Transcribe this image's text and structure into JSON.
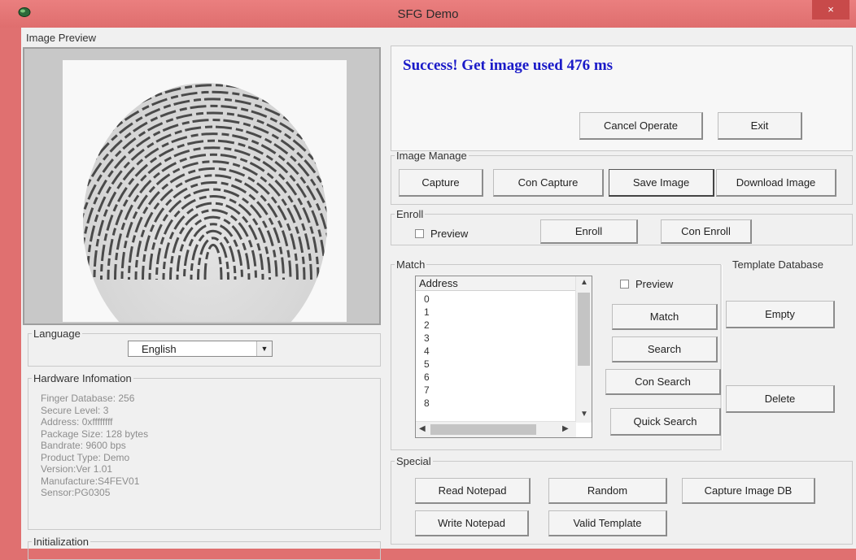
{
  "window": {
    "title": "SFG Demo",
    "close_glyph": "×",
    "icon": "app-icon"
  },
  "preview": {
    "label": "Image Preview",
    "image": "fingerprint-image"
  },
  "status": {
    "message": "Success! Get image used 476 ms",
    "cancel_label": "Cancel Operate",
    "exit_label": "Exit"
  },
  "image_manage": {
    "title": "Image Manage",
    "capture": "Capture",
    "con_capture": "Con Capture",
    "save_image": "Save Image",
    "download_image": "Download Image"
  },
  "enroll": {
    "title": "Enroll",
    "preview_label": "Preview",
    "preview_checked": false,
    "enroll_label": "Enroll",
    "con_enroll_label": "Con Enroll"
  },
  "match": {
    "title": "Match",
    "list_header": "Address",
    "addresses": [
      "0",
      "1",
      "2",
      "3",
      "4",
      "5",
      "6",
      "7",
      "8"
    ],
    "preview_label": "Preview",
    "preview_checked": false,
    "match_label": "Match",
    "search_label": "Search",
    "con_search_label": "Con Search",
    "quick_search_label": "Quick Search"
  },
  "template_db": {
    "title": "Template Database",
    "empty_label": "Empty",
    "delete_label": "Delete"
  },
  "special": {
    "title": "Special",
    "read_notepad": "Read Notepad",
    "random": "Random",
    "capture_image_db": "Capture Image DB",
    "write_notepad": "Write Notepad",
    "valid_template": "Valid Template"
  },
  "language": {
    "title": "Language",
    "selected": "English"
  },
  "hardware": {
    "title": "Hardware Infomation",
    "lines": [
      "Finger Database: 256",
      "Secure Level: 3",
      "Address: 0xffffffff",
      "Package Size: 128 bytes",
      "Bandrate: 9600 bps",
      "Product Type:  Demo",
      "Version:Ver 1.01",
      "Manufacture:S4FEV01",
      "Sensor:PG0305"
    ]
  },
  "initialization": {
    "title": "Initialization"
  }
}
